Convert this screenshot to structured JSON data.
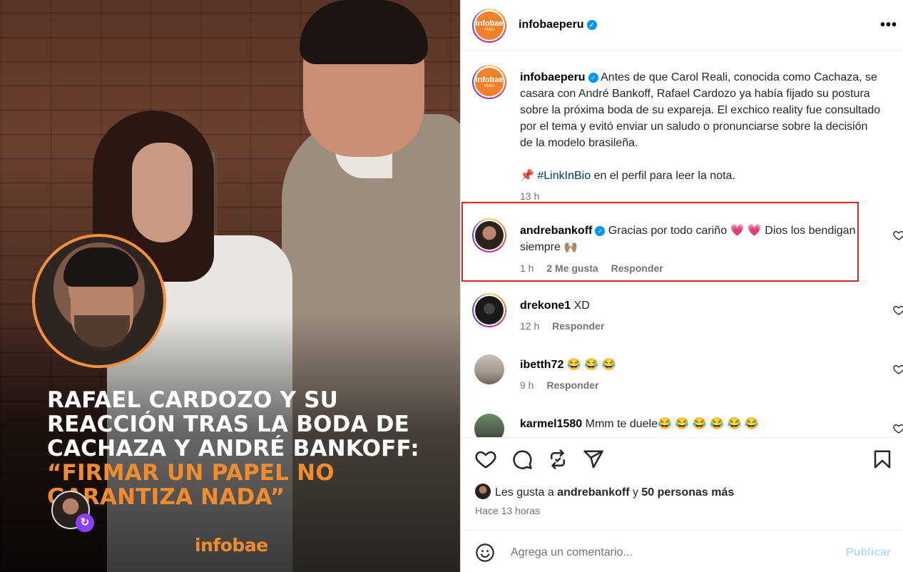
{
  "media": {
    "headline_white": "RAFAEL CARDOZO Y SU REACCIÓN TRAS LA BODA DE CACHAZA Y ANDRÉ BANKOFF:",
    "headline_orange": "“FIRMAR UN PAPEL NO GARANTIZA NADA”",
    "brand": "infobae"
  },
  "header": {
    "avatar_text": "infobae",
    "avatar_sub": "PERÚ",
    "username": "infobaeperu",
    "verified_mark": "✓",
    "more": "•••"
  },
  "caption": {
    "username": "infobaeperu",
    "text": "Antes de que Carol Reali, conocida como Cachaza, se casara con André Bankoff, Rafael Cardozo ya había fijado su postura sobre la próxima boda de su expareja. El exchico reality fue consultado por el tema y evitó enviar un saludo o pronunciarse sobre la decisión de la modelo brasileña.",
    "pin": "📌",
    "hashtag": "#LinkInBio",
    "link_text": " en el perfil para leer la nota.",
    "time": "13 h"
  },
  "comments": [
    {
      "username": "andrebankoff",
      "verified": true,
      "text": "Gracias por todo cariño 💗 💗  Dios los bendigan siempre 🙌🏽",
      "time": "1 h",
      "likes": "2 Me gusta",
      "reply": "Responder"
    },
    {
      "username": "drekone1",
      "verified": false,
      "text": "XD",
      "time": "12 h",
      "reply": "Responder"
    },
    {
      "username": "ibetth72",
      "verified": false,
      "text": "😂 😂 😂",
      "time": "9 h",
      "reply": "Responder"
    },
    {
      "username": "karmel1580",
      "verified": false,
      "text": "Mmm te duele😂 😂 😂 😂 😂 😂"
    }
  ],
  "likes": {
    "prefix": "Les gusta a ",
    "user": "andrebankoff",
    "middle": " y ",
    "others": "50 personas más",
    "time_ago": "Hace 13 horas"
  },
  "add_comment": {
    "placeholder": "Agrega un comentario...",
    "publish": "Publicar"
  },
  "colors": {
    "accent_orange": "#f08c2d",
    "verified_blue": "#0095f6",
    "highlight_red": "#d42a2a",
    "publish_disabled": "#b2dffc"
  },
  "icons": [
    "heart-icon",
    "comment-icon",
    "repost-icon",
    "share-icon",
    "bookmark-icon",
    "emoji-icon",
    "more-icon",
    "verified-icon"
  ]
}
